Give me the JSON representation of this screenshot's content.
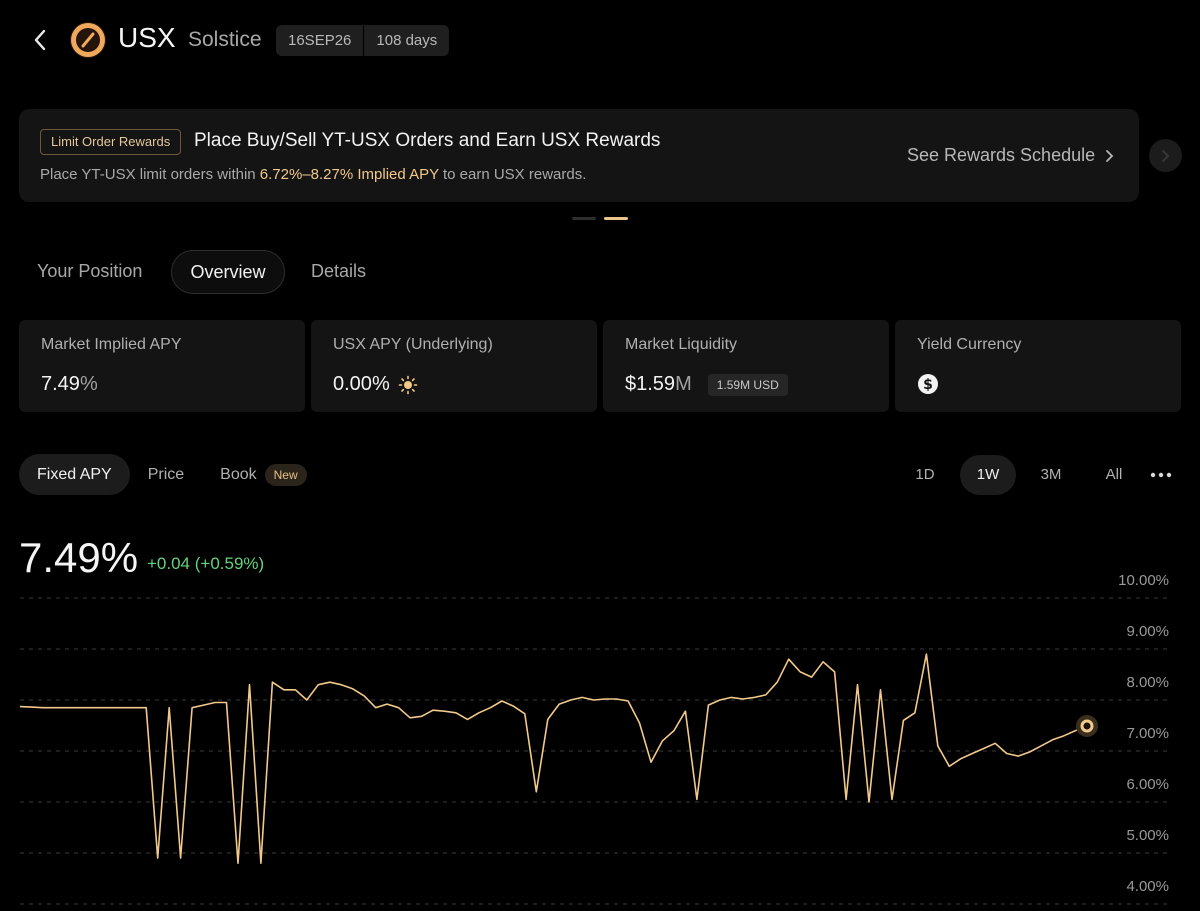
{
  "header": {
    "ticker": "USX",
    "issuer": "Solstice",
    "maturity": "16SEP26",
    "days_left": "108 days"
  },
  "banner": {
    "tag": "Limit Order Rewards",
    "title": "Place Buy/Sell YT-USX Orders and Earn USX Rewards",
    "sub_pre": "Place YT-USX limit orders within ",
    "sub_highlight": "6.72%–8.27% Implied APY",
    "sub_post": " to earn USX rewards.",
    "link": "See Rewards Schedule",
    "accent": "#f2c98a"
  },
  "tabs": {
    "position": "Your Position",
    "overview": "Overview",
    "details": "Details",
    "active": "Overview"
  },
  "stats": [
    {
      "label": "Market Implied APY",
      "value": "7.49",
      "unit": "%"
    },
    {
      "label": "USX APY (Underlying)",
      "value": "0.00",
      "unit": "%",
      "icon": "sun-icon"
    },
    {
      "label": "Market Liquidity",
      "value": "$1.59",
      "unit": "M",
      "chip": "1.59M USD"
    },
    {
      "label": "Yield Currency",
      "icon": "dollar-coin-icon"
    }
  ],
  "chart_tabs": {
    "fixed": "Fixed APY",
    "price": "Price",
    "book": "Book",
    "book_badge": "New",
    "active": "Fixed APY"
  },
  "ranges": {
    "d1": "1D",
    "w1": "1W",
    "m3": "3M",
    "all": "All",
    "active": "1W"
  },
  "current": {
    "apy": "7.49%",
    "change": "+0.04 (+0.59%)",
    "change_color": "#66d27a"
  },
  "chart_data": {
    "type": "line",
    "title": "",
    "xlabel": "",
    "ylabel": "",
    "ylim": [
      4.0,
      10.0
    ],
    "y_ticks": [
      "10.00%",
      "9.00%",
      "8.00%",
      "7.00%",
      "6.00%",
      "5.00%",
      "4.00%"
    ],
    "grid": true,
    "line_color": "#f2c98a",
    "series": [
      {
        "values": [
          7.87,
          7.86,
          7.85,
          7.85,
          7.85,
          7.85,
          7.85,
          7.85,
          7.85,
          7.85,
          7.85,
          7.85,
          4.9,
          7.85,
          4.9,
          7.85,
          7.9,
          7.95,
          7.95,
          4.8,
          8.3,
          4.8,
          8.35,
          8.2,
          8.2,
          8.0,
          8.3,
          8.35,
          8.3,
          8.22,
          8.08,
          7.85,
          7.92,
          7.85,
          7.65,
          7.68,
          7.8,
          7.78,
          7.75,
          7.62,
          7.75,
          7.85,
          7.98,
          7.88,
          7.73,
          6.2,
          7.62,
          7.92,
          8.0,
          8.05,
          8.0,
          8.02,
          8.02,
          7.98,
          7.55,
          6.78,
          7.2,
          7.4,
          7.78,
          6.05,
          7.9,
          8.0,
          8.05,
          8.02,
          8.05,
          8.1,
          8.35,
          8.8,
          8.55,
          8.45,
          8.75,
          8.55,
          6.05,
          8.3,
          6.0,
          8.2,
          6.05,
          7.6,
          7.75,
          8.9,
          7.1,
          6.7,
          6.85,
          6.95,
          7.05,
          7.15,
          6.95,
          6.9,
          6.98,
          7.1,
          7.22,
          7.3,
          7.4,
          7.49
        ]
      }
    ]
  }
}
